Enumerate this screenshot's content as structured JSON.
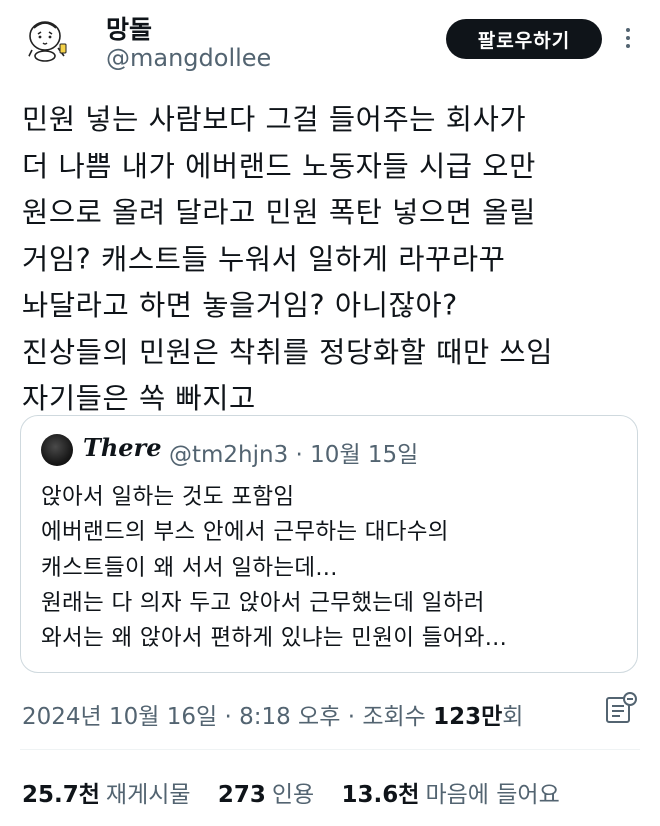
{
  "header": {
    "display_name": "망돌",
    "handle": "@mangdollee",
    "follow_label": "팔로우하기"
  },
  "tweet": {
    "lines": [
      "민원 넣는 사람보다 그걸 들어주는 회사가",
      "더 나쁨 내가 에버랜드 노동자들 시급 오만",
      "원으로 올려 달라고 민원 폭탄 넣으면 올릴",
      "거임? 캐스트들 누워서 일하게 라꾸라꾸",
      "놔달라고 하면 놓을거임? 아니잖아?",
      "진상들의 민원은 착취를 정당화할 때만 쓰임",
      "자기들은 쏙 빠지고"
    ]
  },
  "quote": {
    "name": "There",
    "handle": "@tm2hjn3",
    "separator": "·",
    "date": "10월 15일",
    "lines": [
      "앉아서 일하는 것도 포함임",
      "에버랜드의 부스 안에서 근무하는 대다수의",
      "캐스트들이 왜 서서 일하는데...",
      "원래는 다 의자 두고 앉아서 근무했는데 일하러",
      "와서는 왜 앉아서 편하게 있냐는 민원이 들어와..."
    ]
  },
  "timestamp": {
    "text": "2024년 10월 16일 · 8:18 오후 · 조회수 ",
    "views_number": "123",
    "views_unit": "만",
    "views_suffix": "회"
  },
  "stats": {
    "retweets": {
      "value": "25.7천",
      "label": "재게시물"
    },
    "quotes": {
      "value": "273",
      "label": "인용"
    },
    "likes": {
      "value": "13.6천",
      "label": "마음에 들어요"
    }
  },
  "icons": {
    "more": "more-dots-icon",
    "analytics": "analytics-icon"
  }
}
